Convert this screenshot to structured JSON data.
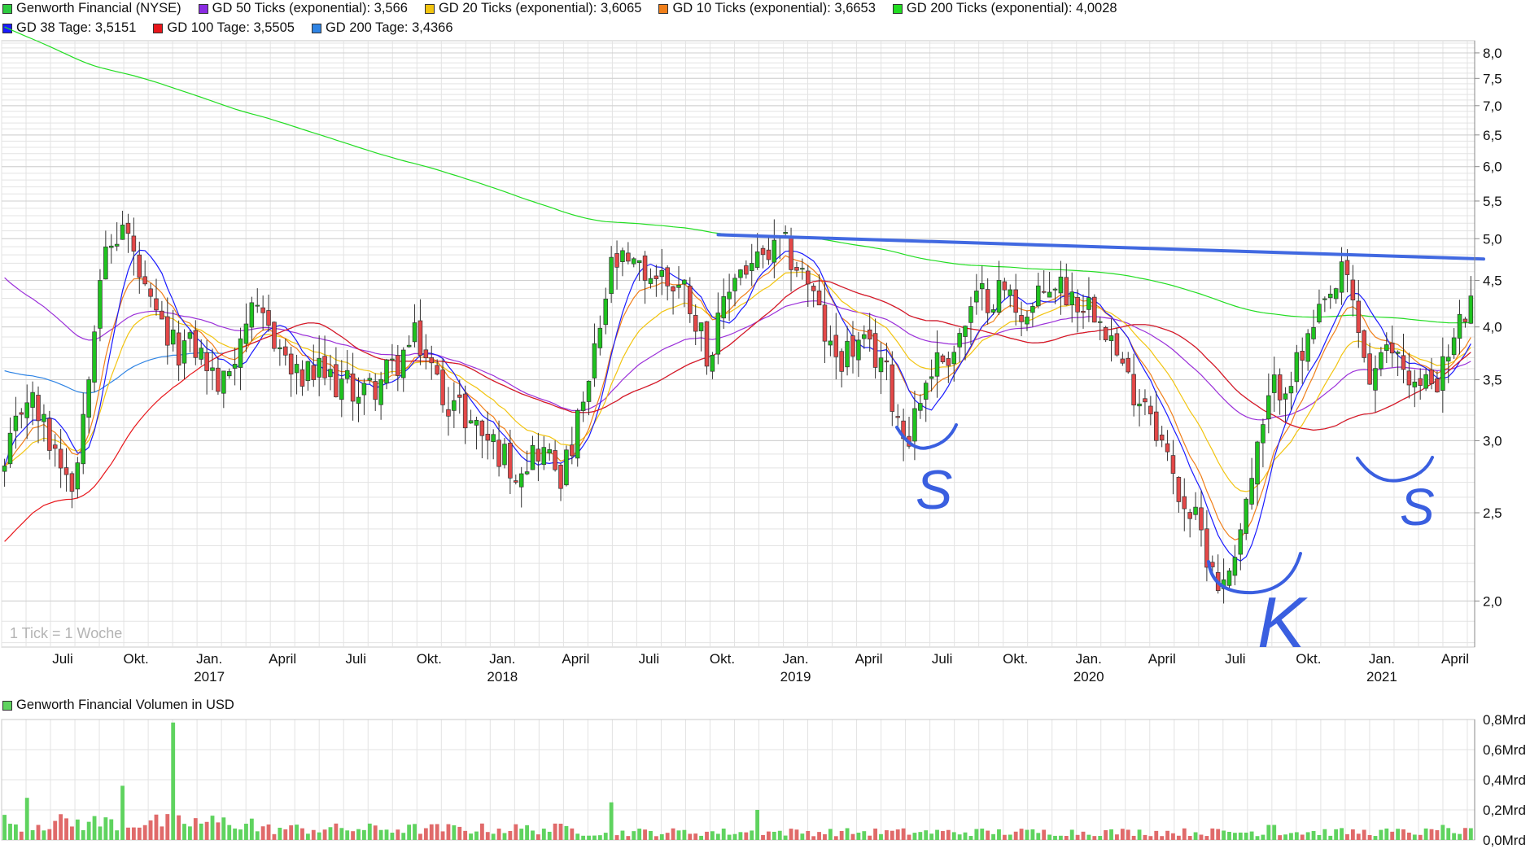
{
  "legend": [
    {
      "label": "Genworth Financial (NYSE)",
      "color": "#2ecc40"
    },
    {
      "label": "GD 50 Ticks (exponential): 3,566",
      "color": "#8a2be2"
    },
    {
      "label": "GD 20 Ticks (exponential): 3,6065",
      "color": "#f2c40f"
    },
    {
      "label": "GD 10 Ticks (exponential): 3,6653",
      "color": "#f07f1a"
    },
    {
      "label": "GD 200 Ticks (exponential): 4,0028",
      "color": "#22dd22"
    },
    {
      "label": "GD 38 Tage: 3,5151",
      "color": "#1a1aff"
    },
    {
      "label": "GD 100 Tage: 3,5505",
      "color": "#e8161b"
    },
    {
      "label": "GD 200 Tage: 3,4366",
      "color": "#2f84e4"
    }
  ],
  "watermark": "1 Tick = 1 Woche",
  "volume_label": "Genworth Financial Volumen in USD",
  "annotations": [
    "S",
    "K",
    "S"
  ],
  "chart_data": [
    {
      "type": "candlestick",
      "title": "Genworth Financial (NYSE)",
      "yscale": "log",
      "ylim": [
        1.78,
        8.25
      ],
      "y_ticks": [
        "2,0",
        "2,5",
        "3,0",
        "3,5",
        "4,0",
        "4,5",
        "5,0",
        "5,5",
        "6,0",
        "6,5",
        "7,0",
        "7,5",
        "8,0"
      ],
      "y_tick_values": [
        2.0,
        2.5,
        3.0,
        3.5,
        4.0,
        4.5,
        5.0,
        5.5,
        6.0,
        6.5,
        7.0,
        7.5,
        8.0
      ],
      "x_month_labels": [
        "Juli",
        "Okt.",
        "Jan.",
        "April",
        "Juli",
        "Okt.",
        "Jan.",
        "April",
        "Juli",
        "Okt.",
        "Jan.",
        "April",
        "Juli",
        "Okt.",
        "Jan.",
        "April",
        "Juli",
        "Okt.",
        "Jan.",
        "April"
      ],
      "x_year_labels": [
        "2017",
        "2018",
        "2019",
        "2020",
        "2021"
      ],
      "x_dates": [
        "2016-07",
        "2016-10",
        "2017-01",
        "2017-04",
        "2017-07",
        "2017-10",
        "2018-01",
        "2018-04",
        "2018-07",
        "2018-10",
        "2019-01",
        "2019-04",
        "2019-07",
        "2019-10",
        "2020-01",
        "2020-04",
        "2020-07",
        "2020-10",
        "2021-01",
        "2021-04"
      ],
      "close_anchors": [
        [
          "2016-05",
          2.7
        ],
        [
          "2016-06",
          3.4
        ],
        [
          "2016-07",
          3.0
        ],
        [
          "2016-08",
          2.7
        ],
        [
          "2016-09",
          4.6
        ],
        [
          "2016-10",
          5.2
        ],
        [
          "2016-11",
          4.2
        ],
        [
          "2016-12",
          3.8
        ],
        [
          "2017-01",
          3.8
        ],
        [
          "2017-02",
          3.4
        ],
        [
          "2017-03",
          4.1
        ],
        [
          "2017-04",
          4.0
        ],
        [
          "2017-05",
          3.5
        ],
        [
          "2017-06",
          3.55
        ],
        [
          "2017-07",
          3.45
        ],
        [
          "2017-08",
          3.4
        ],
        [
          "2017-09",
          3.6
        ],
        [
          "2017-10",
          3.9
        ],
        [
          "2017-11",
          3.4
        ],
        [
          "2017-12",
          3.2
        ],
        [
          "2018-01",
          3.0
        ],
        [
          "2018-02",
          2.8
        ],
        [
          "2018-03",
          2.95
        ],
        [
          "2018-04",
          2.75
        ],
        [
          "2018-05",
          3.4
        ],
        [
          "2018-06",
          4.7
        ],
        [
          "2018-07",
          4.6
        ],
        [
          "2018-08",
          4.55
        ],
        [
          "2018-09",
          4.4
        ],
        [
          "2018-10",
          3.7
        ],
        [
          "2018-11",
          4.6
        ],
        [
          "2018-12",
          4.7
        ],
        [
          "2019-01",
          4.9
        ],
        [
          "2019-02",
          4.5
        ],
        [
          "2019-03",
          3.7
        ],
        [
          "2019-04",
          3.8
        ],
        [
          "2019-05",
          3.7
        ],
        [
          "2019-06",
          3.0
        ],
        [
          "2019-07",
          3.6
        ],
        [
          "2019-08",
          3.8
        ],
        [
          "2019-09",
          4.3
        ],
        [
          "2019-10",
          4.4
        ],
        [
          "2019-11",
          4.1
        ],
        [
          "2019-12",
          4.5
        ],
        [
          "2020-01",
          4.3
        ],
        [
          "2020-02",
          4.2
        ],
        [
          "2020-03",
          3.5
        ],
        [
          "2020-04",
          3.3
        ],
        [
          "2020-05",
          2.7
        ],
        [
          "2020-06",
          2.4
        ],
        [
          "2020-07",
          2.05
        ],
        [
          "2020-08",
          2.6
        ],
        [
          "2020-09",
          3.4
        ],
        [
          "2020-10",
          3.6
        ],
        [
          "2020-11",
          4.1
        ],
        [
          "2020-12",
          4.6
        ],
        [
          "2021-01",
          3.5
        ],
        [
          "2021-02",
          3.8
        ],
        [
          "2021-03",
          3.4
        ],
        [
          "2021-04",
          3.6
        ],
        [
          "2021-05",
          4.2
        ]
      ],
      "series": [
        {
          "name": "GD 50 Ticks (exponential)",
          "last": 3.566,
          "color": "#9b30d9"
        },
        {
          "name": "GD 20 Ticks (exponential)",
          "last": 3.6065,
          "color": "#f2c40f"
        },
        {
          "name": "GD 10 Ticks (exponential)",
          "last": 3.6653,
          "color": "#f07f1a"
        },
        {
          "name": "GD 200 Ticks (exponential)",
          "last": 4.0028,
          "color": "#22dd22"
        },
        {
          "name": "GD 38 Tage",
          "last": 3.5151,
          "color": "#1a1aff"
        },
        {
          "name": "GD 100 Tage",
          "last": 3.5505,
          "color": "#e8161b"
        },
        {
          "name": "GD 200 Tage",
          "last": 3.4366,
          "color": "#2f84e4"
        }
      ],
      "resistance_line": [
        [
          "2018-10",
          5.05
        ],
        [
          "2021-05",
          4.75
        ]
      ],
      "grid": true,
      "legend_position": "top-left"
    },
    {
      "type": "bar",
      "title": "Genworth Financial Volumen in USD",
      "ylim": [
        0,
        0.8
      ],
      "y_ticks": [
        "0,0Mrd",
        "0,2Mrd",
        "0,4Mrd",
        "0,6Mrd",
        "0,8Mrd"
      ],
      "peaks": [
        [
          "2016-06",
          0.28
        ],
        [
          "2016-10",
          0.36
        ],
        [
          "2016-12",
          0.78
        ],
        [
          "2018-06",
          0.25
        ],
        [
          "2018-12",
          0.2
        ],
        [
          "2020-09",
          0.1
        ],
        [
          "2021-04",
          0.1
        ]
      ],
      "typical": 0.05,
      "grid": true
    }
  ]
}
